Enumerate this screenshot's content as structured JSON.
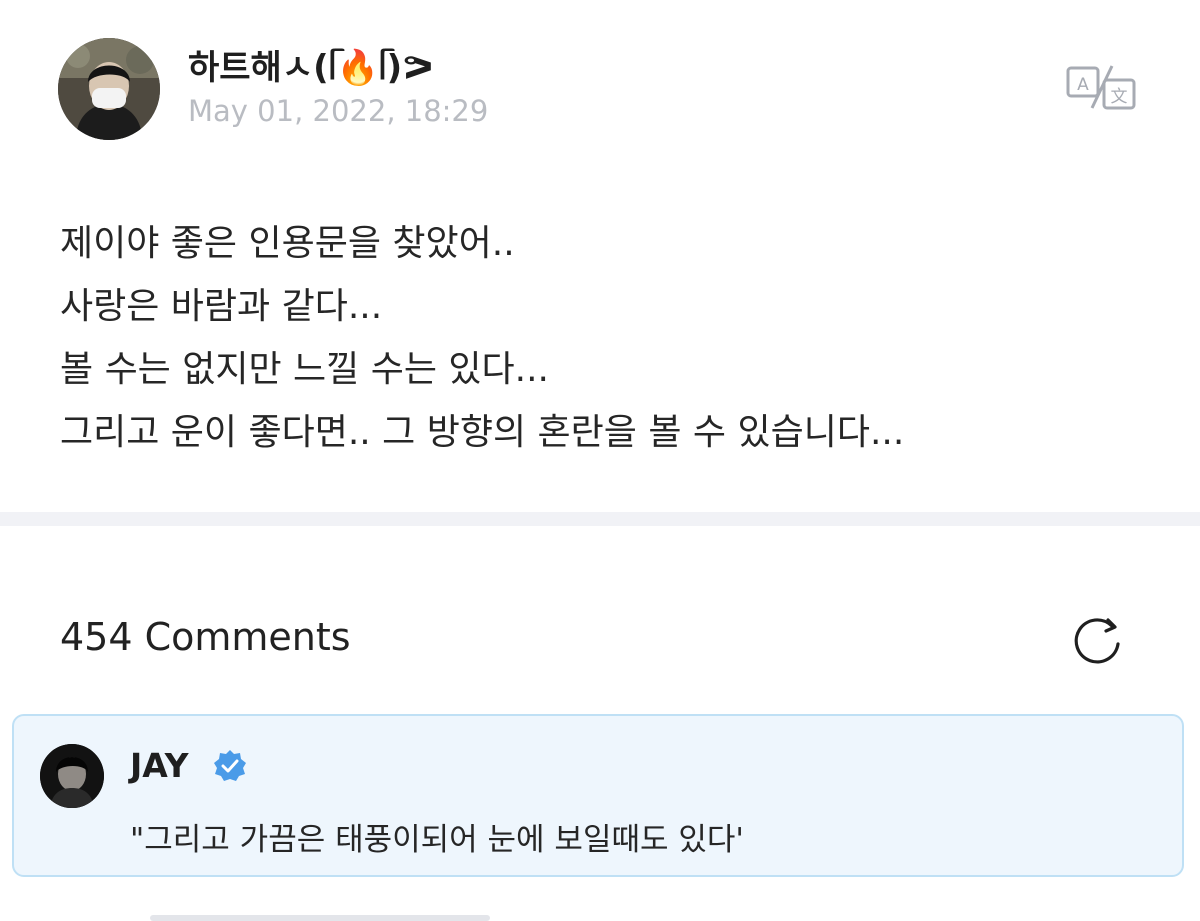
{
  "post": {
    "author_name": "하트해ㅅ(ᥬ🔥ᥬ)ᕗ",
    "date": "May 01, 2022, 18:29",
    "body_lines": [
      "제이야 좋은 인용문을 찾았어..",
      "사랑은 바람과 같다...",
      "볼 수는 없지만 느낄 수는 있다...",
      "그리고 운이 좋다면.. 그 방향의 혼란을 볼 수 있습니다..."
    ]
  },
  "comments": {
    "title": "454 Comments",
    "items": [
      {
        "author": "JAY",
        "text": "\"그리고 가끔은 태풍이되어 눈에 보일때도 있다'"
      }
    ]
  },
  "icons": {
    "translate": "translate-icon",
    "refresh": "refresh-icon",
    "verified": "verified-badge-icon"
  },
  "colors": {
    "comment_bg": "#eef6fd",
    "comment_border": "#bfe0f5",
    "verified": "#4a9be8",
    "date": "#b9bcc2",
    "divider": "#f1f2f6"
  }
}
